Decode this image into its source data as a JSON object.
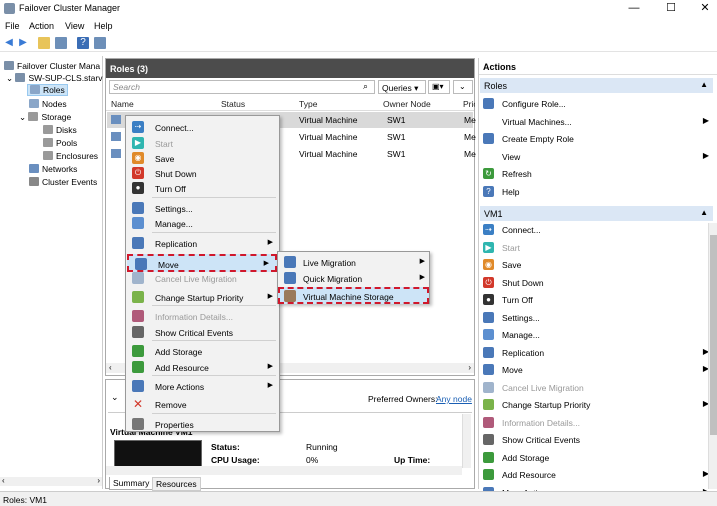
{
  "window": {
    "title": "Failover Cluster Manager",
    "minimize": "—",
    "maximize": "☐",
    "close": "✕"
  },
  "menu": [
    "File",
    "Action",
    "View",
    "Help"
  ],
  "tree": {
    "root": "Failover Cluster Mana",
    "cluster": "SW-SUP-CLS.starv",
    "items": [
      "Roles",
      "Nodes",
      "Storage",
      "Disks",
      "Pools",
      "Enclosures",
      "Networks",
      "Cluster Events"
    ]
  },
  "roles": {
    "title": "Roles (3)",
    "search_placeholder": "Search",
    "queries_label": "Queries",
    "columns": [
      "Name",
      "Status",
      "Type",
      "Owner Node",
      "Prio"
    ],
    "rows": [
      {
        "type": "Virtual Machine",
        "owner": "SW1",
        "prio": "Me"
      },
      {
        "type": "Virtual Machine",
        "owner": "SW1",
        "prio": "Me"
      },
      {
        "type": "Virtual Machine",
        "owner": "SW1",
        "prio": "Me"
      }
    ]
  },
  "detail": {
    "preferred_owners_label": "Preferred Owners:",
    "any_node": "Any node",
    "vm_title": "Virtual Machine VM1",
    "status_label": "Status:",
    "status_value": "Running",
    "cpu_label": "CPU Usage:",
    "cpu_value": "0%",
    "uptime_label": "Up Time:",
    "tabs": [
      "Summary",
      "Resources"
    ]
  },
  "context_menu": [
    {
      "label": "Connect...",
      "icon": "connect-icon",
      "color": "#3b7fc4",
      "enabled": true
    },
    {
      "label": "Start",
      "icon": "start-icon",
      "color": "#2fb6b0",
      "enabled": false
    },
    {
      "label": "Save",
      "icon": "save-icon",
      "color": "#e08a2a",
      "enabled": true
    },
    {
      "label": "Shut Down",
      "icon": "shutdown-icon",
      "color": "#d2382a",
      "enabled": true
    },
    {
      "label": "Turn Off",
      "icon": "turnoff-icon",
      "color": "#333333",
      "enabled": true
    },
    {
      "label": "Settings...",
      "icon": "settings-icon",
      "color": "#4a78b8",
      "enabled": true
    },
    {
      "label": "Manage...",
      "icon": "manage-icon",
      "color": "#5c8fd0",
      "enabled": true
    },
    {
      "label": "Replication",
      "icon": "replication-icon",
      "color": "#4a78b8",
      "enabled": true,
      "submenu": true
    },
    {
      "label": "Move",
      "icon": "move-icon",
      "color": "#4a78b8",
      "enabled": true,
      "submenu": true
    },
    {
      "label": "Cancel Live Migration",
      "icon": "cancel-migration-icon",
      "color": "#a0b4cc",
      "enabled": false
    },
    {
      "label": "Change Startup Priority",
      "icon": "priority-icon",
      "color": "#7ab34a",
      "enabled": true,
      "submenu": true
    },
    {
      "label": "Information Details...",
      "icon": "info-details-icon",
      "color": "#b05a7a",
      "enabled": false
    },
    {
      "label": "Show Critical Events",
      "icon": "critical-events-icon",
      "color": "#666666",
      "enabled": true
    },
    {
      "label": "Add Storage",
      "icon": "add-storage-icon",
      "color": "#3c9a3c",
      "enabled": true
    },
    {
      "label": "Add Resource",
      "icon": "add-resource-icon",
      "color": "#3c9a3c",
      "enabled": true,
      "submenu": true
    },
    {
      "label": "More Actions",
      "icon": "more-actions-icon",
      "color": "#4a78b8",
      "enabled": true,
      "submenu": true
    },
    {
      "label": "Remove",
      "icon": "remove-icon",
      "color": "#d2382a",
      "enabled": true
    },
    {
      "label": "Properties",
      "icon": "properties-icon",
      "color": "#777777",
      "enabled": true
    }
  ],
  "move_submenu": [
    "Live Migration",
    "Quick Migration",
    "Virtual Machine Storage"
  ],
  "actions": {
    "title": "Actions",
    "roles_section": "Roles",
    "roles_items": [
      {
        "label": "Configure Role...",
        "icon": "configure-role-icon",
        "color": "#4a78b8"
      },
      {
        "label": "Virtual Machines...",
        "icon": "none",
        "color": "",
        "submenu": true
      },
      {
        "label": "Create Empty Role",
        "icon": "create-role-icon",
        "color": "#4a78b8"
      },
      {
        "label": "View",
        "icon": "none",
        "color": "",
        "submenu": true
      },
      {
        "label": "Refresh",
        "icon": "refresh-icon",
        "color": "#3c9a3c"
      },
      {
        "label": "Help",
        "icon": "help-icon",
        "color": "#4a78b8"
      }
    ],
    "vm_section": "VM1",
    "vm_items": [
      {
        "label": "Connect...",
        "icon": "connect-icon",
        "color": "#3b7fc4"
      },
      {
        "label": "Start",
        "icon": "start-icon",
        "color": "#2fb6b0",
        "disabled": true
      },
      {
        "label": "Save",
        "icon": "save-icon",
        "color": "#e08a2a"
      },
      {
        "label": "Shut Down",
        "icon": "shutdown-icon",
        "color": "#d2382a"
      },
      {
        "label": "Turn Off",
        "icon": "turnoff-icon",
        "color": "#333333"
      },
      {
        "label": "Settings...",
        "icon": "settings-icon",
        "color": "#4a78b8"
      },
      {
        "label": "Manage...",
        "icon": "manage-icon",
        "color": "#5c8fd0"
      },
      {
        "label": "Replication",
        "icon": "replication-icon",
        "color": "#4a78b8",
        "submenu": true
      },
      {
        "label": "Move",
        "icon": "move-icon",
        "color": "#4a78b8",
        "submenu": true
      },
      {
        "label": "Cancel Live Migration",
        "icon": "cancel-migration-icon",
        "color": "#a0b4cc",
        "disabled": true
      },
      {
        "label": "Change Startup Priority",
        "icon": "priority-icon",
        "color": "#7ab34a",
        "submenu": true
      },
      {
        "label": "Information Details...",
        "icon": "info-details-icon",
        "color": "#b05a7a",
        "disabled": true
      },
      {
        "label": "Show Critical Events",
        "icon": "critical-events-icon",
        "color": "#666666"
      },
      {
        "label": "Add Storage",
        "icon": "add-storage-icon",
        "color": "#3c9a3c"
      },
      {
        "label": "Add Resource",
        "icon": "add-resource-icon",
        "color": "#3c9a3c",
        "submenu": true
      },
      {
        "label": "More Actions",
        "icon": "more-actions-icon",
        "color": "#4a78b8",
        "submenu": true
      }
    ]
  },
  "status_bar": "Roles: VM1"
}
